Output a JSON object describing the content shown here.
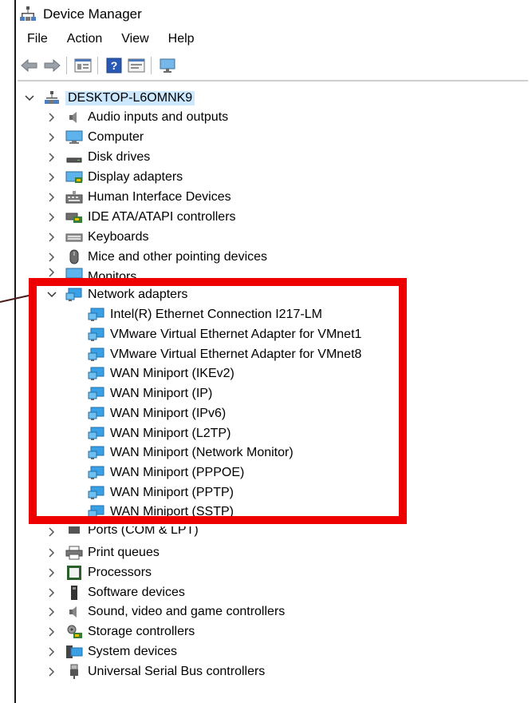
{
  "window": {
    "title": "Device Manager",
    "app_icon": "device-manager-icon"
  },
  "menu": [
    "File",
    "Action",
    "View",
    "Help"
  ],
  "toolbar": {
    "buttons": [
      "back-arrow-icon",
      "forward-arrow-icon",
      "properties-icon",
      "help-icon",
      "view-icon",
      "scan-hardware-icon"
    ]
  },
  "tree": {
    "root": {
      "label": "DESKTOP-L6OMNK9",
      "expanded": true
    },
    "categories_before": [
      {
        "label": "Audio inputs and outputs",
        "icon": "speaker-icon"
      },
      {
        "label": "Computer",
        "icon": "monitor-icon"
      },
      {
        "label": "Disk drives",
        "icon": "disk-drive-icon"
      },
      {
        "label": "Display adapters",
        "icon": "display-adapter-icon"
      },
      {
        "label": "Human Interface Devices",
        "icon": "hid-icon"
      },
      {
        "label": "IDE ATA/ATAPI controllers",
        "icon": "ide-controller-icon"
      },
      {
        "label": "Keyboards",
        "icon": "keyboard-icon"
      },
      {
        "label": "Mice and other pointing devices",
        "icon": "mouse-icon"
      },
      {
        "label": "Monitors",
        "icon": "monitor-icon"
      }
    ],
    "network": {
      "label": "Network adapters",
      "expanded": true,
      "children": [
        "Intel(R) Ethernet Connection I217-LM",
        "VMware Virtual Ethernet Adapter for VMnet1",
        "VMware Virtual Ethernet Adapter for VMnet8",
        "WAN Miniport (IKEv2)",
        "WAN Miniport (IP)",
        "WAN Miniport (IPv6)",
        "WAN Miniport (L2TP)",
        "WAN Miniport (Network Monitor)",
        "WAN Miniport (PPPOE)",
        "WAN Miniport (PPTP)",
        "WAN Miniport (SSTP)"
      ]
    },
    "categories_after": [
      {
        "label": "Ports (COM & LPT)",
        "icon": "port-icon"
      },
      {
        "label": "Print queues",
        "icon": "printer-icon"
      },
      {
        "label": "Processors",
        "icon": "processor-icon"
      },
      {
        "label": "Software devices",
        "icon": "software-device-icon"
      },
      {
        "label": "Sound, video and game controllers",
        "icon": "speaker-icon"
      },
      {
        "label": "Storage controllers",
        "icon": "storage-controller-icon"
      },
      {
        "label": "System devices",
        "icon": "system-device-icon"
      },
      {
        "label": "Universal Serial Bus controllers",
        "icon": "usb-icon"
      }
    ]
  },
  "colors": {
    "highlight": "#ee0000",
    "selection": "#cce8ff",
    "network_icon": "#2f8fd6"
  }
}
